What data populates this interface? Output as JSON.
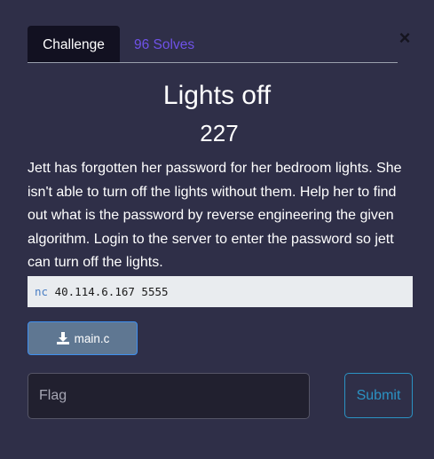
{
  "tabs": [
    {
      "label": "Challenge",
      "active": true
    },
    {
      "label": "96 Solves",
      "active": false
    }
  ],
  "close": {
    "label": "×",
    "icon": "close-icon"
  },
  "challenge": {
    "name": "Lights off",
    "points": "227",
    "description": "Jett has forgotten her password for her bedroom lights. She isn't able to turn off the lights without them. Help her to find out what is the password by reverse engineering the given algorithm. Login to the server to enter the password so jett can turn off the lights.",
    "connection": {
      "command": "nc",
      "args": "40.114.6.167 5555"
    }
  },
  "file": {
    "label": "main.c",
    "icon": "download-icon"
  },
  "flag_input": {
    "placeholder": "Flag",
    "value": ""
  },
  "submit": {
    "label": "Submit"
  },
  "colors": {
    "background": "#2f2f48",
    "active_tab": "#121121",
    "inactive_tab_text": "#6f52e8",
    "submit_accent": "#2b92c3",
    "file_button": "#5f7792"
  }
}
